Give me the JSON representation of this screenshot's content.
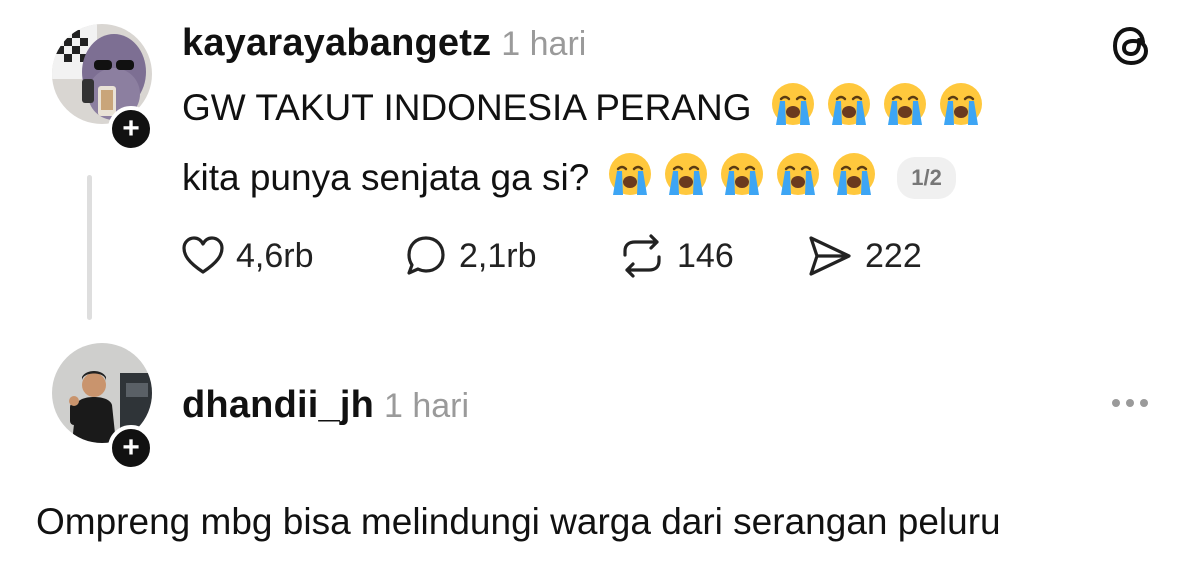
{
  "post": {
    "username": "kayarayabangetz",
    "time": "1 hari",
    "line1": "GW TAKUT INDONESIA PERANG",
    "line1_emoji_count": 4,
    "line2": "kita punya senjata ga si?",
    "line2_emoji_count": 5,
    "emoji_name": "loudly-crying-face",
    "page_indicator": "1/2",
    "actions": {
      "like_count": "4,6rb",
      "comment_count": "2,1rb",
      "repost_count": "146",
      "share_count": "222"
    },
    "follow_symbol": "+"
  },
  "reply": {
    "username": "dhandii_jh",
    "time": "1 hari",
    "body": "Ompreng mbg bisa melindungi warga dari serangan peluru",
    "follow_symbol": "+"
  },
  "colors": {
    "text": "#111111",
    "muted": "#9a9a9a",
    "thread_line": "#dedede",
    "emoji_face": "#FFC83D",
    "emoji_tears": "#3DA5F4"
  },
  "icons": [
    "threads-logo-icon",
    "heart-icon",
    "comment-icon",
    "repost-icon",
    "share-icon",
    "more-icon",
    "plus-icon"
  ]
}
